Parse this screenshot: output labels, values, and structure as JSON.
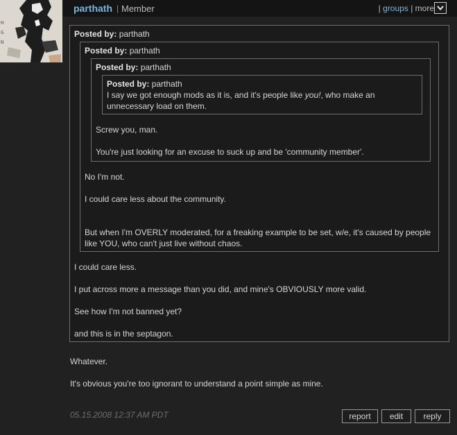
{
  "header": {
    "username": "parthath",
    "separator": "|",
    "role": "Member",
    "links_prefix": "|",
    "groups_label": "groups",
    "more_separator": "|",
    "more_label": "more",
    "accent_color": "#79b6df",
    "avatar_letters": "HGN"
  },
  "quotes": {
    "posted_by_label": "Posted by:",
    "level1": {
      "author": "parthath",
      "paragraphs": [
        "I could care less.",
        "I put across more a message than you did, and mine's OBVIOUSLY more valid.",
        "See how I'm not banned yet?",
        "and this is in the septagon."
      ]
    },
    "level2": {
      "author": "parthath",
      "paragraphs": [
        "No I'm not.",
        "I could care less about the community.",
        "But when I'm OVERLY moderated, for a freaking example to be set, w/e, it's caused by people like YOU, who can't just live without chaos."
      ]
    },
    "level3": {
      "author": "parthath",
      "paragraphs": [
        "Screw you, man.",
        "You're just looking for an excuse to suck up and be 'community member'."
      ]
    },
    "level4": {
      "author": "parthath",
      "text_before": "I say we got enough mods as it is, and it's people like ",
      "text_emph": "you!",
      "text_after": ", who make an unnecessary load on them."
    }
  },
  "body": {
    "paragraphs": [
      "Whatever.",
      "It's obvious you're too ignorant to understand a point simple as mine."
    ]
  },
  "footer": {
    "timestamp": "05.15.2008 12:37 AM PDT",
    "report_label": "report",
    "edit_label": "edit",
    "reply_label": "reply"
  }
}
